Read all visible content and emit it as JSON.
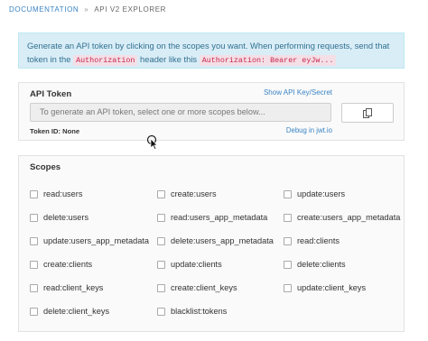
{
  "breadcrumb": {
    "link": "Documentation",
    "separator": "»",
    "current": "API V2 Explorer"
  },
  "info": {
    "text_1": "Generate an API token by clicking on the scopes you want. When performing requests, send that token in the",
    "code_1": "Authorization",
    "text_2": "header like this",
    "code_2": "Authorization: Bearer eyJw..."
  },
  "token_panel": {
    "title": "API Token",
    "show_key_link": "Show API Key/Secret",
    "input_placeholder": "To generate an API token, select one or more scopes below...",
    "token_id_label": "Token ID: None",
    "debug_link": "Debug in jwt.io",
    "copy_icon": "copy-icon"
  },
  "scopes_panel": {
    "title": "Scopes",
    "items": [
      "read:users",
      "create:users",
      "update:users",
      "delete:users",
      "read:users_app_metadata",
      "create:users_app_metadata",
      "update:users_app_metadata",
      "delete:users_app_metadata",
      "read:clients",
      "create:clients",
      "update:clients",
      "delete:clients",
      "read:client_keys",
      "create:client_keys",
      "update:client_keys",
      "delete:client_keys",
      "blacklist:tokens"
    ]
  },
  "colors": {
    "link": "#3a84c4",
    "info_bg": "#d9edf7",
    "info_text": "#31708f",
    "code_text": "#c7254e"
  }
}
